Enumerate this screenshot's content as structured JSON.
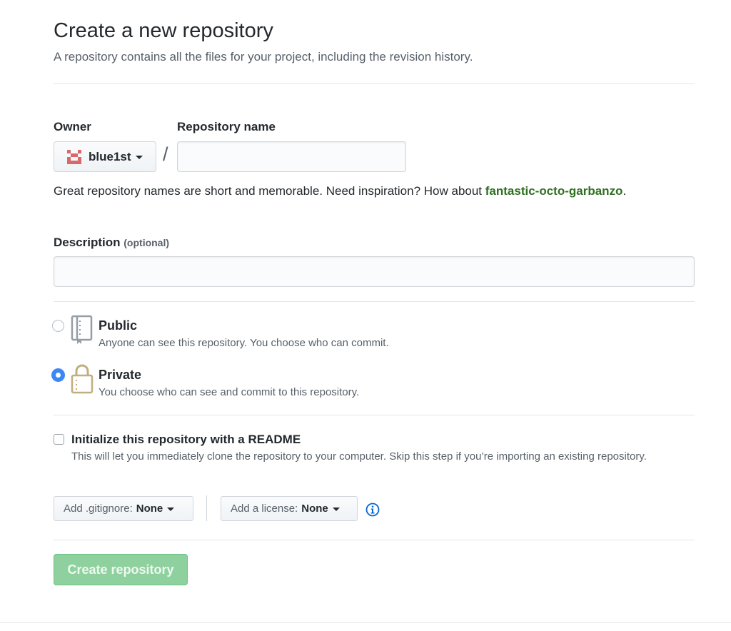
{
  "page": {
    "title": "Create a new repository",
    "subtitle": "A repository contains all the files for your project, including the revision history."
  },
  "owner": {
    "label": "Owner",
    "value": "blue1st",
    "avatar_color": "#d8696b"
  },
  "separator": "/",
  "repo_name": {
    "label": "Repository name",
    "value": "",
    "placeholder": ""
  },
  "name_help": {
    "text": "Great repository names are short and memorable. Need inspiration? How about ",
    "suggestion": "fantastic-octo-garbanzo",
    "end": "."
  },
  "description": {
    "label": "Description",
    "optional": "(optional)",
    "value": "",
    "placeholder": ""
  },
  "visibility": {
    "selected": "private",
    "public": {
      "title": "Public",
      "desc": "Anyone can see this repository. You choose who can commit.",
      "icon": "repo-book-icon"
    },
    "private": {
      "title": "Private",
      "desc": "You choose who can see and commit to this repository.",
      "icon": "lock-icon"
    }
  },
  "readme": {
    "checked": false,
    "title": "Initialize this repository with a README",
    "desc": "This will let you immediately clone the repository to your computer. Skip this step if you’re importing an existing repository."
  },
  "gitignore": {
    "label": "Add .gitignore:",
    "value": "None"
  },
  "license": {
    "label": "Add a license:",
    "value": "None"
  },
  "submit": {
    "label": "Create repository",
    "disabled": true
  },
  "colors": {
    "accent_blue": "#3b87f5",
    "suggestion_green": "#2f6f22",
    "button_green": "#8fd19e",
    "lock_gold": "#c1ae7e"
  }
}
